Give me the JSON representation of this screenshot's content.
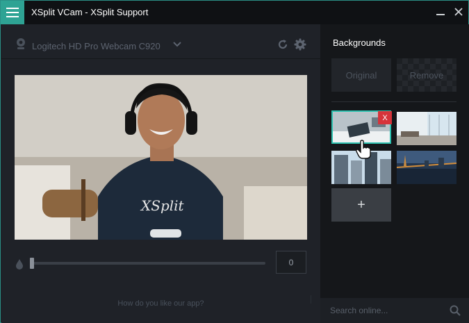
{
  "window": {
    "title": "XSplit VCam - XSplit Support"
  },
  "camera": {
    "name": "Logitech HD Pro Webcam C920"
  },
  "blur": {
    "value": "0",
    "level": 0
  },
  "feedback": {
    "text": "How do you like our app?"
  },
  "backgrounds": {
    "title": "Backgrounds",
    "original_label": "Original",
    "remove_label": "Remove",
    "delete_label": "X",
    "add_label": "+",
    "thumbnails": [
      "office-desk",
      "bright-interior",
      "city-skyscrapers",
      "city-bridge-night"
    ],
    "selected_index": 0
  },
  "search": {
    "placeholder": "Search online..."
  },
  "colors": {
    "accent": "#2ea394",
    "selection": "#2ec2b0",
    "delete": "#d6343b",
    "border": "#2b8f86"
  },
  "icons": [
    "menu-icon",
    "minimize-icon",
    "close-icon",
    "webcam-icon",
    "chevron-down-icon",
    "refresh-icon",
    "gear-icon",
    "droplet-icon",
    "cursor-hand-icon",
    "search-icon"
  ]
}
